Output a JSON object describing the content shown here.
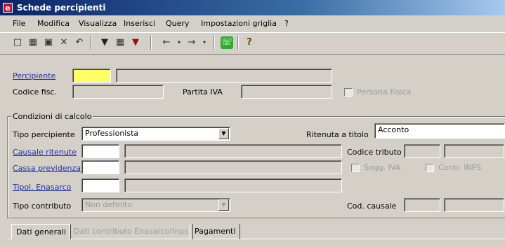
{
  "window": {
    "title": "Schede percipienti"
  },
  "menu": [
    "File",
    "Modifica",
    "Visualizza",
    "Inserisci",
    "Query",
    "Impostazioni griglia",
    "?"
  ],
  "toolbar": {
    "icons": [
      "new-icon",
      "save-grid-icon",
      "save-icon",
      "delete-icon",
      "undo-icon",
      "filter-icon",
      "grid-icon",
      "filter-clear-icon",
      "back-arrow-icon",
      "forward-arrow-icon",
      "phone-icon",
      "help-icon"
    ]
  },
  "form": {
    "percipiente_label": "Percipiente",
    "percipiente_code": "",
    "percipiente_name": "",
    "codice_fisc_label": "Codice fisc.",
    "codice_fisc_value": "",
    "partita_iva_label": "Partita IVA",
    "partita_iva_value": "",
    "persona_fisica_label": "Persona Fisica",
    "persona_fisica_checked": false
  },
  "condizioni": {
    "title": "Condizioni di calcolo",
    "tipo_percipiente_label": "Tipo percipiente",
    "tipo_percipiente_value": "Professionista",
    "ritenuta_label": "Ritenuta a titolo",
    "ritenuta_value": "Acconto",
    "causale_label": "Causale ritenute",
    "codice_tributo_label": "Codice tributo",
    "cassa_label": "Cassa previdenza",
    "sogg_iva_label": "Sogg. IVA",
    "contr_inps_label": "Contr. INPS",
    "tipol_enasarco_label": "Tipol. Enasarco",
    "tipo_contributo_label": "Tipo contributo",
    "tipo_contributo_value": "Non definito",
    "cod_causale_label": "Cod. causale"
  },
  "tabs": [
    "Dati generali",
    "Dati contributo Enasarco/Inps",
    "Pagamenti"
  ],
  "colors": {
    "titlebar": "#0a246a",
    "link": "#1f2bb0",
    "highlight_field": "#ffff66"
  }
}
